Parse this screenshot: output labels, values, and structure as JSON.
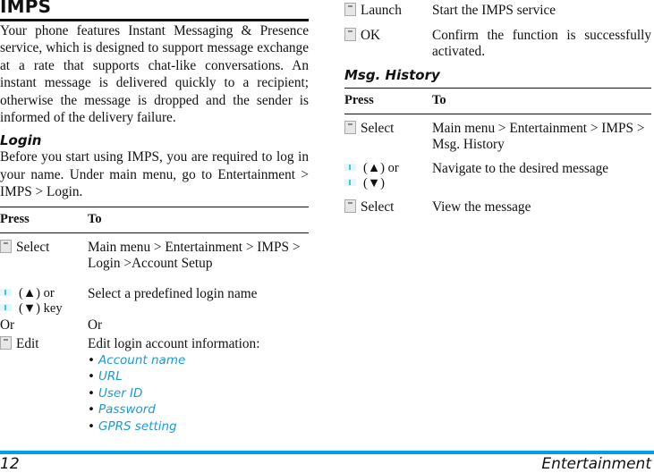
{
  "left": {
    "title": "IMPS",
    "intro": "Your phone features Instant Messaging & Presence service, which is designed to support message exchange at a rate that supports chat-like conversations. An instant message is delivered quickly to a recipient; otherwise the message is dropped and the sender is informed of the delivery failure.",
    "login": {
      "heading": "Login",
      "text": "Before you start using IMPS, you are required to log in your name. Under main menu, go to Entertainment > IMPS > Login.",
      "table": {
        "headers": [
          "Press",
          "To"
        ],
        "rows": [
          {
            "icon": "softkey-icon",
            "press": "Select",
            "to": "Main menu > Entertainment > IMPS > Login >Account Setup"
          },
          {
            "icon": "nav-key-icon",
            "press_lines": [
              "(▲) or",
              "(▼) key"
            ],
            "press_or": "Or",
            "to": "Select a predefined login name",
            "to_or": "Or"
          },
          {
            "icon": "softkey-icon",
            "press": "Edit",
            "to": "Edit login account information:",
            "options": [
              "Account name",
              "URL",
              "User ID",
              "Password",
              "GPRS setting"
            ]
          }
        ]
      }
    }
  },
  "right": {
    "rows_top": [
      {
        "icon": "softkey-icon",
        "press": "Launch",
        "to": "Start the IMPS service"
      },
      {
        "icon": "softkey-icon",
        "press": "OK",
        "to": "Confirm the function is successfully activated."
      }
    ],
    "msg_history": {
      "heading": "Msg. History",
      "table": {
        "headers": [
          "Press",
          "To"
        ],
        "rows": [
          {
            "icon": "softkey-icon",
            "press": "Select",
            "to": "Main menu > Entertainment > IMPS > Msg. History"
          },
          {
            "icon": "nav-key-icon",
            "press_lines": [
              "(▲) or",
              "(▼)"
            ],
            "to": "Navigate to the desired message"
          },
          {
            "icon": "softkey-icon",
            "press": "Select",
            "to": "View the message"
          }
        ]
      }
    }
  },
  "footer": {
    "page_number": "12",
    "section": "Entertainment",
    "accent_color": "#00a0e6"
  },
  "colors": {
    "option_text": "#1a9ad8"
  }
}
